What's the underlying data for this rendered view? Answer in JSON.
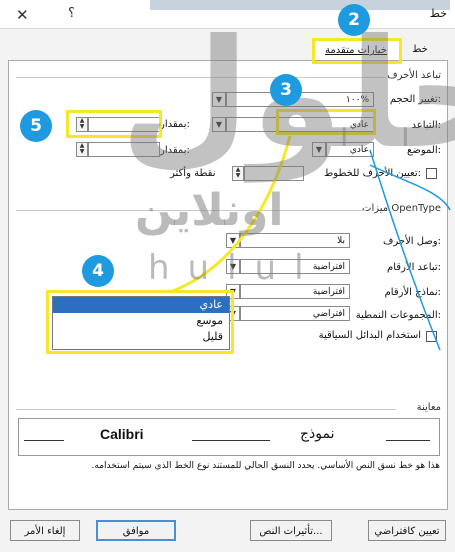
{
  "window": {
    "title": "خط",
    "help_glyph": "؟",
    "close_glyph": "✕"
  },
  "tabs": [
    {
      "label": "خط"
    },
    {
      "label": "خيارات متقدمة"
    }
  ],
  "spacing_section": {
    "title": "تباعد الأحرف",
    "scale_label": "تغيير الحجم:",
    "scale_value": "١٠٠%",
    "spacing_label": "التباعد:",
    "spacing_value": "عادي",
    "by_label_1": "بمقدار:",
    "position_label": "الموضع:",
    "position_value": "عادي",
    "by_label_2": "بمقدار:",
    "kerning_label": "تعيين الأحرف للخطوط:",
    "kerning_suffix": "نقطة وأكثر"
  },
  "opentype_section": {
    "title": "ميزات OpenType",
    "ligatures_label": "وصل الأحرف:",
    "ligatures_value": "بلا",
    "number_spacing_label": "تباعد الأرقام:",
    "number_spacing_value": "افتراضية",
    "number_forms_label": "نماذج الأرقام:",
    "number_forms_value": "افتراضية",
    "stylistic_sets_label": "المجموعات النمطية:",
    "stylistic_sets_value": "افتراضي",
    "contextual_alternates_label": "استخدام البدائل السياقية"
  },
  "spacing_dropdown": {
    "options": [
      "عادي",
      "موسع",
      "قليل"
    ],
    "selected_index": 0
  },
  "preview": {
    "title": "معاينة",
    "text_left": "Calibri",
    "text_right": "نموذج",
    "note": "هذا هو خط نسق النص الأساسي. يحدد النسق الحالي للمستند نوع الخط الذي سيتم استخدامه."
  },
  "buttons": {
    "set_default": "تعيين كافتراضي",
    "text_effects": "تأثيرات النص...",
    "ok": "موافق",
    "cancel": "إلغاء الأمر"
  },
  "callouts": [
    "2",
    "3",
    "4",
    "5"
  ],
  "watermark": {
    "brand_ar": "حلول",
    "brand_ar_alt": "اونلاين",
    "brand_en": "hulul"
  },
  "colors": {
    "callout": "#1e9be0",
    "highlight": "#f6e829",
    "selection": "#2c6fc1"
  }
}
